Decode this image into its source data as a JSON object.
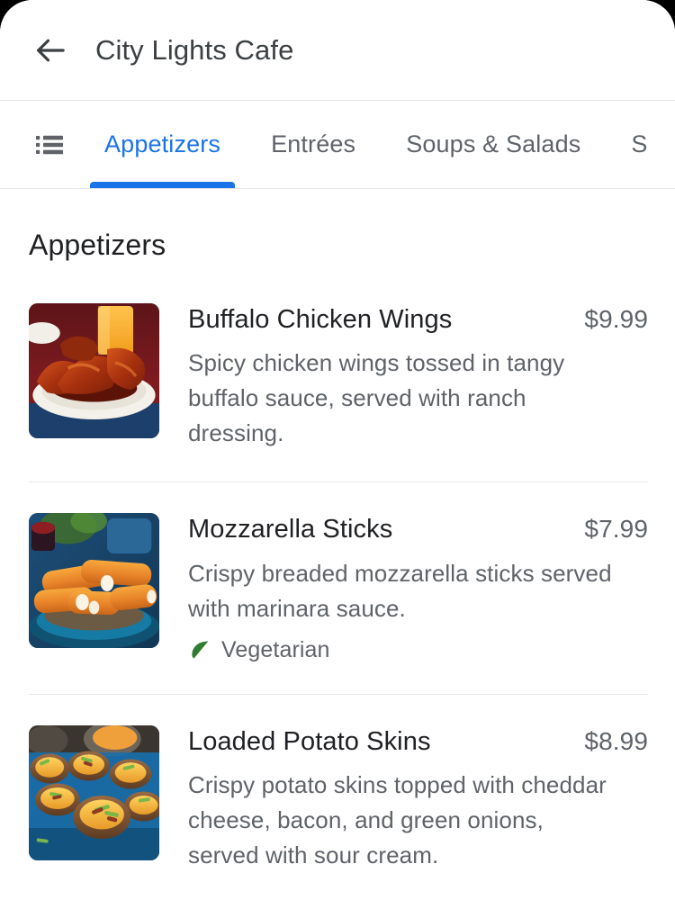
{
  "appbar": {
    "back_icon": "arrow-back-icon",
    "title": "City Lights Cafe"
  },
  "tabbar": {
    "menu_icon": "list-bulleted-icon",
    "active_tab": "Appetizers",
    "accent_color": "#1a73e8",
    "inactive_color": "#5f6368",
    "tabs": [
      {
        "label": "Appetizers",
        "active": true
      },
      {
        "label": "Entrées",
        "active": false
      },
      {
        "label": "Soups & Salads",
        "active": false
      },
      {
        "label": "S",
        "active": false
      }
    ]
  },
  "content": {
    "section_title": "Appetizers",
    "items": [
      {
        "name": "Buffalo Chicken Wings",
        "price": "$9.99",
        "description": "Spicy chicken wings tossed in tangy buffalo sauce, served with ranch dressing.",
        "image_alt": "buffalo-chicken-wings-photo",
        "tags": []
      },
      {
        "name": "Mozzarella Sticks",
        "price": "$7.99",
        "description": "Crispy breaded mozzarella sticks served with marinara sauce.",
        "image_alt": "mozzarella-sticks-photo",
        "tags": [
          {
            "label": "Vegetarian",
            "icon": "leaf-icon",
            "color": "#34a853"
          }
        ]
      },
      {
        "name": "Loaded Potato Skins",
        "price": "$8.99",
        "description": "Crispy potato skins topped with cheddar cheese, bacon, and green onions, served with sour cream.",
        "image_alt": "loaded-potato-skins-photo",
        "tags": []
      }
    ]
  }
}
